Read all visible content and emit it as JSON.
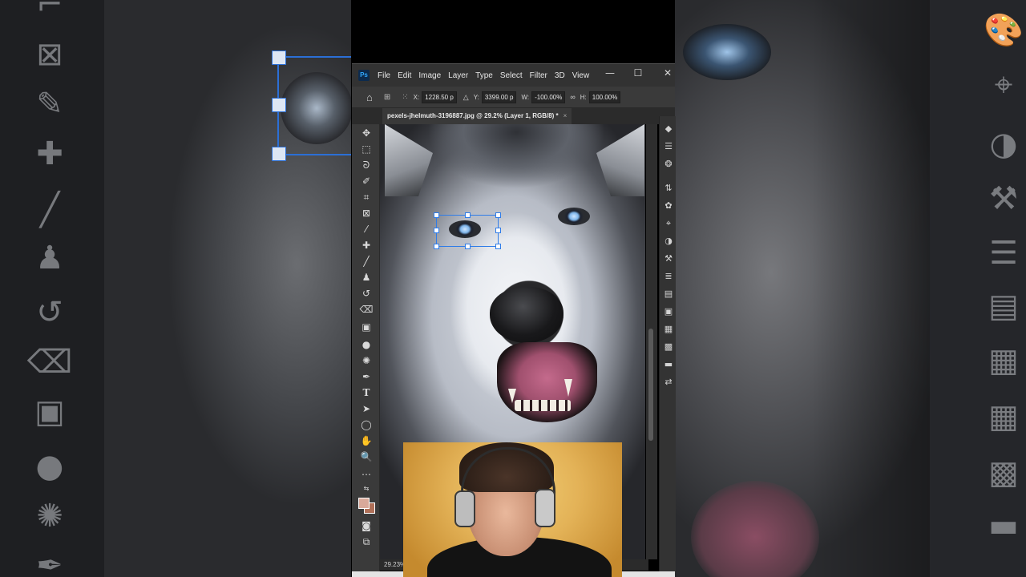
{
  "app": {
    "logo": "Ps",
    "menu": [
      "File",
      "Edit",
      "Image",
      "Layer",
      "Type",
      "Select",
      "Filter",
      "3D",
      "View"
    ],
    "window_controls": {
      "minimize": "—",
      "maximize": "☐",
      "close": "✕"
    }
  },
  "options_bar": {
    "x_label": "X:",
    "x_value": "1228.50 p",
    "y_label": "Y:",
    "y_value": "3399.00 p",
    "w_label": "W:",
    "w_value": "-100.00%",
    "h_label": "H:",
    "h_value": "100.00%"
  },
  "document": {
    "tab_title": "pexels-jhelmuth-3196887.jpg @ 29.2% (Layer 1, RGB/8) *",
    "tab_close": "×",
    "zoom_status": "29.23%"
  },
  "tools": [
    "move-tool",
    "marquee-tool",
    "lasso-tool",
    "quick-select-tool",
    "crop-tool",
    "frame-tool",
    "eyedropper-tool",
    "healing-brush-tool",
    "brush-tool",
    "clone-stamp-tool",
    "history-brush-tool",
    "eraser-tool",
    "gradient-tool",
    "blur-tool",
    "dodge-tool",
    "pen-tool",
    "type-tool",
    "path-selection-tool",
    "ellipse-tool",
    "hand-tool",
    "zoom-tool",
    "edit-toolbar"
  ],
  "colors": {
    "foreground": "#d9a99a",
    "background": "#b07058",
    "selection": "#2f7ce8",
    "ui_bg": "#323232"
  }
}
